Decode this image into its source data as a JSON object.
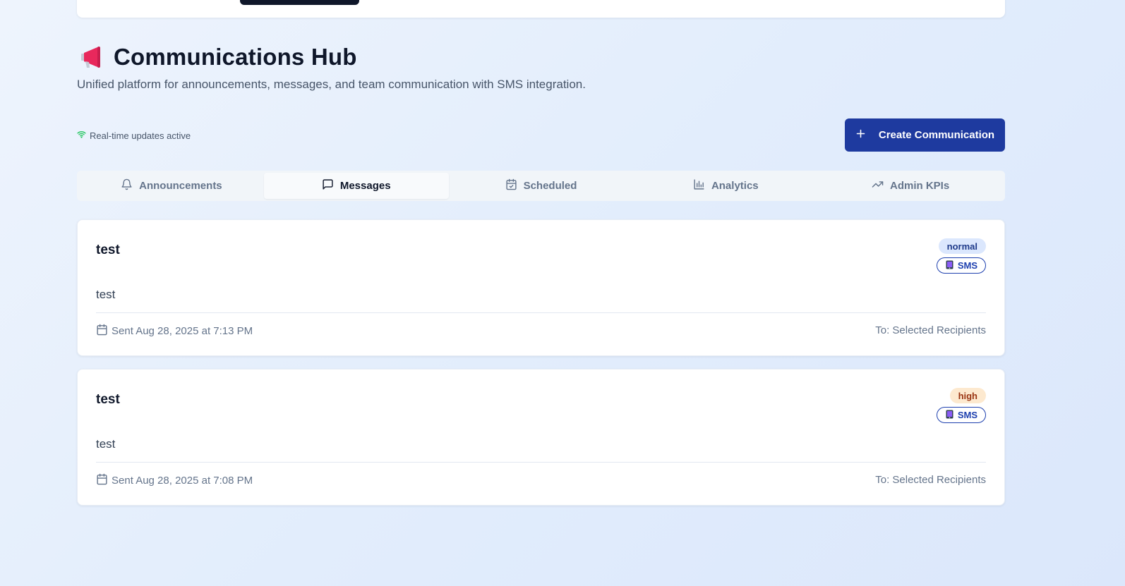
{
  "header": {
    "title": "Communications Hub",
    "subtitle": "Unified platform for announcements, messages, and team communication with SMS integration."
  },
  "status": {
    "text": "Real-time updates active",
    "color": "#22c55e"
  },
  "create_button": {
    "icon": "plus-icon",
    "label": "Create Communication"
  },
  "tabs": [
    {
      "icon": "bell-icon",
      "label": "Announcements",
      "active": false
    },
    {
      "icon": "message-square-icon",
      "label": "Messages",
      "active": true
    },
    {
      "icon": "calendar-check-icon",
      "label": "Scheduled",
      "active": false
    },
    {
      "icon": "bar-chart-icon",
      "label": "Analytics",
      "active": false
    },
    {
      "icon": "trending-up-icon",
      "label": "Admin KPIs",
      "active": false
    }
  ],
  "messages": [
    {
      "title": "test",
      "body": "test",
      "priority": "normal",
      "channel": "SMS",
      "sent": "Sent Aug 28, 2025 at 7:13 PM",
      "recipients": "To: Selected Recipients"
    },
    {
      "title": "test",
      "body": "test",
      "priority": "high",
      "channel": "SMS",
      "sent": "Sent Aug 28, 2025 at 7:08 PM",
      "recipients": "To: Selected Recipients"
    }
  ],
  "colors": {
    "primary": "#1e3a9f",
    "normal_badge_bg": "#dbe7fd",
    "high_badge_bg": "#fde9cf"
  }
}
